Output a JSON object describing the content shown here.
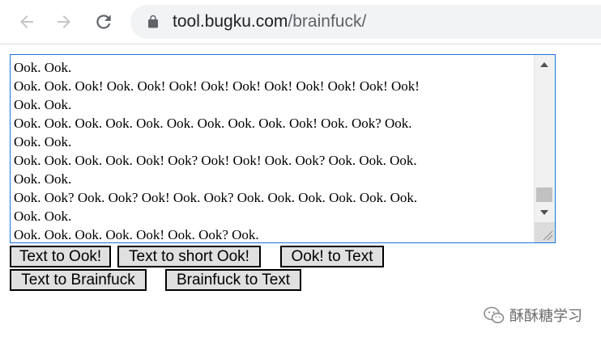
{
  "browser": {
    "url_host": "tool.bugku.com",
    "url_path": "/brainfuck/",
    "back_icon": "arrow-left-icon",
    "forward_icon": "arrow-right-icon",
    "reload_icon": "reload-icon",
    "lock_icon": "lock-icon"
  },
  "textarea": {
    "lines": [
      "Ook. Ook.",
      "Ook. Ook. Ook! Ook. Ook! Ook! Ook! Ook! Ook! Ook! Ook! Ook! Ook!",
      "Ook. Ook.",
      "Ook. Ook. Ook. Ook. Ook. Ook. Ook. Ook. Ook. Ook! Ook. Ook? Ook.",
      "Ook. Ook.",
      "Ook. Ook. Ook. Ook. Ook! Ook? Ook! Ook! Ook. Ook? Ook. Ook. Ook.",
      "Ook. Ook.",
      "Ook. Ook? Ook. Ook? Ook! Ook. Ook? Ook. Ook. Ook. Ook. Ook. Ook.",
      "Ook. Ook.",
      "Ook. Ook. Ook. Ook. Ook! Ook. Ook? Ook."
    ]
  },
  "buttons": {
    "text_to_ook": "Text to Ook!",
    "text_to_short_ook": "Text to short Ook!",
    "ook_to_text": "Ook! to Text",
    "text_to_brainfuck": "Text to Brainfuck",
    "brainfuck_to_text": "Brainfuck to Text"
  },
  "watermark": {
    "text": "酥酥糖学习",
    "icon": "wechat-icon"
  }
}
